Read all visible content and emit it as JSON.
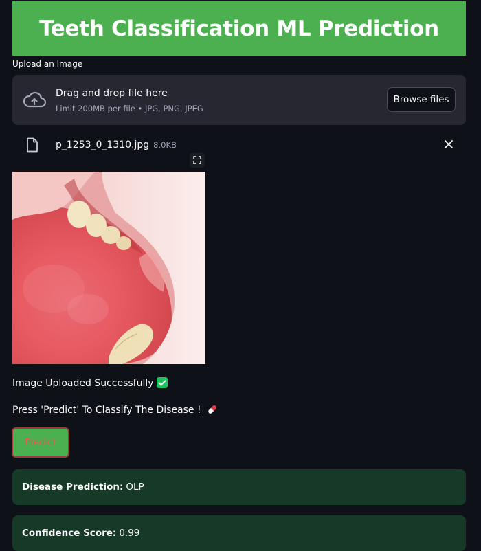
{
  "header": {
    "title": "Teeth Classification ML Prediction"
  },
  "uploader": {
    "label": "Upload an Image",
    "drop_title": "Drag and drop file here",
    "drop_limit": "Limit 200MB per file • JPG, PNG, JPEG",
    "browse_label": "Browse files"
  },
  "file": {
    "name": "p_1253_0_1310.jpg",
    "size": "8.0KB"
  },
  "messages": {
    "uploaded": "Image Uploaded Successfully",
    "press_predict": "Press 'Predict' To Classify The Disease !"
  },
  "predict_button": {
    "label": "Predict"
  },
  "results": {
    "prediction_label": "Disease Prediction:",
    "prediction_value": "OLP",
    "confidence_label": "Confidence Score:",
    "confidence_value": "0.99"
  },
  "colors": {
    "banner": "#4caf50",
    "background": "#0e1117",
    "dropzone": "#262730",
    "result_box": "#173928",
    "success_check": "#21c35f"
  },
  "icons": [
    "cloud-upload-icon",
    "file-icon",
    "close-icon",
    "fullscreen-icon",
    "check-mark-icon",
    "pill-icon"
  ]
}
